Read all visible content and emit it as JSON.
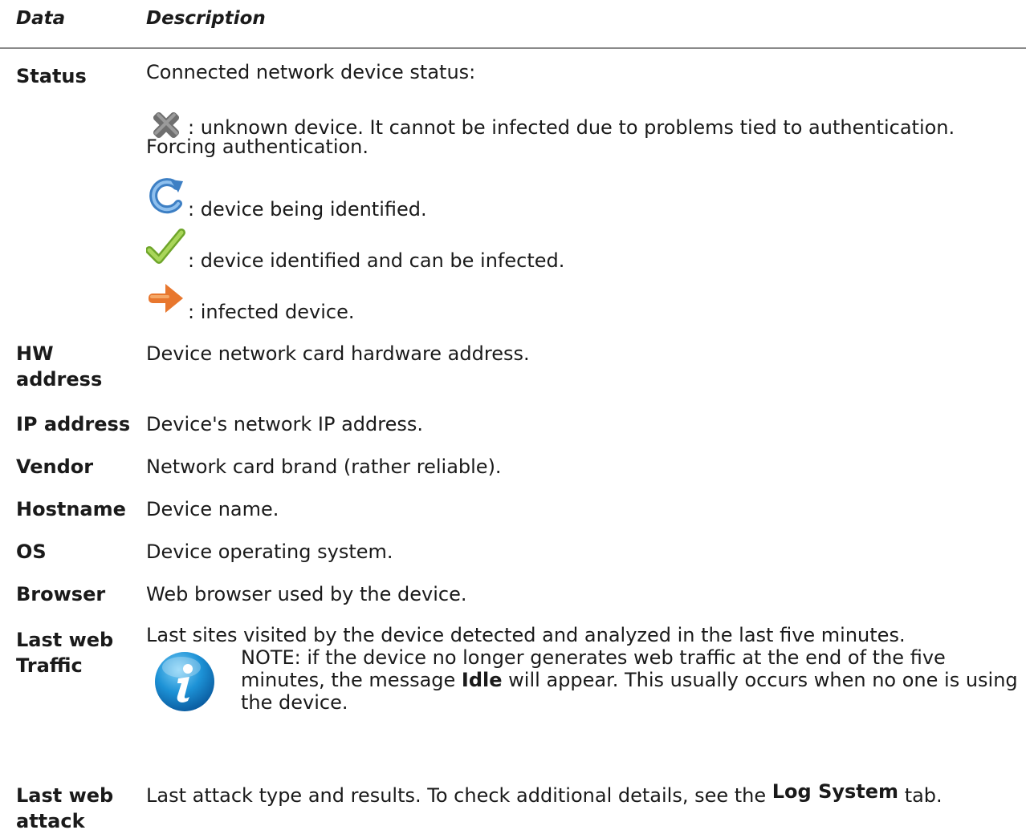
{
  "header": {
    "col_data": "Data",
    "col_description": "Description"
  },
  "status": {
    "term": "Status",
    "intro": "Connected network device status:",
    "items": [
      {
        "icon": "x-cross-icon",
        "text": ": unknown device. It cannot be infected due to problems tied to authentication.",
        "text_cont": "Forcing authentication."
      },
      {
        "icon": "refresh-icon",
        "text": ": device being identified."
      },
      {
        "icon": "checkmark-icon",
        "text": ": device identified and can be infected."
      },
      {
        "icon": "arrow-right-icon",
        "text": ": infected device."
      }
    ]
  },
  "rows": [
    {
      "term_line1": "HW",
      "term_line2": "address",
      "desc": "Device network card hardware address."
    },
    {
      "term": "IP address",
      "desc": "Device's network IP address."
    },
    {
      "term": "Vendor",
      "desc": "Network card brand (rather reliable)."
    },
    {
      "term": "Hostname",
      "desc": "Device name."
    },
    {
      "term": "OS",
      "desc": "Device operating system."
    },
    {
      "term": "Browser",
      "desc": "Web browser used by the device."
    }
  ],
  "last_web_traffic": {
    "term_line1": "Last web",
    "term_line2": "Traffic",
    "desc": "Last sites visited by the device detected and analyzed in the last five minutes.",
    "note": {
      "icon": "info-icon",
      "prefix": "NOTE: if the device no longer generates web traffic at the end of the five minutes, the message ",
      "bold": "Idle",
      "suffix": " will appear. This usually occurs when no one is using the device."
    }
  },
  "last_web_attack": {
    "term_line1": "Last web",
    "term_line2": "attack",
    "desc_prefix": "Last attack type and results. To check additional details, see the ",
    "desc_bold": "Log System",
    "desc_suffix": " tab."
  }
}
